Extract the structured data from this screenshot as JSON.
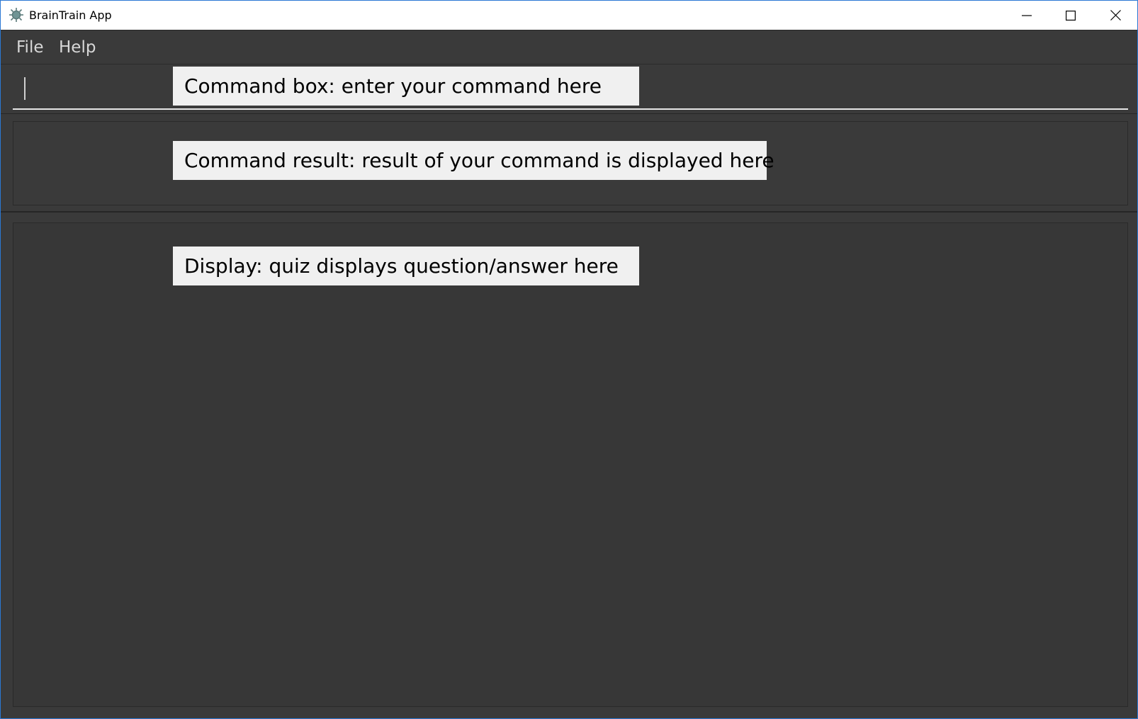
{
  "window": {
    "title": "BrainTrain App",
    "controls": {
      "minimize": "minimize-icon",
      "maximize": "maximize-icon",
      "close": "close-icon"
    }
  },
  "menu": {
    "file": "File",
    "help": "Help"
  },
  "annotations": {
    "command_box": "Command box: enter your command here",
    "command_result": "Command result: result of your command is displayed here",
    "display": "Display: quiz displays question/answer here"
  },
  "colors": {
    "window_background": "#3a3a3a",
    "annotation_background": "#f0f0f0",
    "window_border": "#2b78d4"
  }
}
